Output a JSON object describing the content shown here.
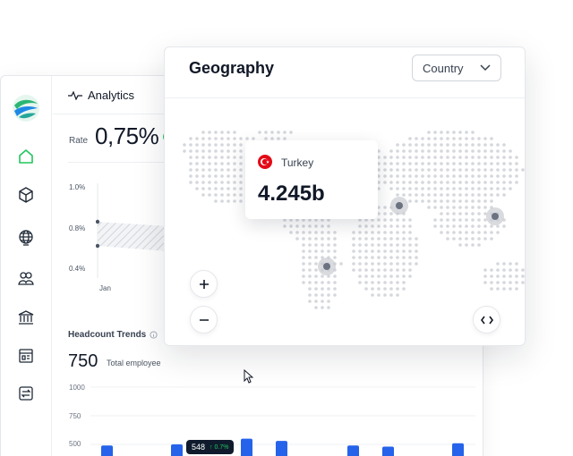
{
  "sidebar": {
    "items": [
      {
        "icon": "home-icon",
        "active": true
      },
      {
        "icon": "cube-icon"
      },
      {
        "icon": "globe-icon"
      },
      {
        "icon": "users-icon"
      },
      {
        "icon": "bank-icon"
      },
      {
        "icon": "store-icon"
      },
      {
        "icon": "exchange-icon"
      }
    ]
  },
  "analytics": {
    "title": "Analytics",
    "rate_label": "Rate",
    "rate_value": "0,75%"
  },
  "rate_chart": {
    "yticks": [
      "1.0%",
      "0.8%",
      "0.4%"
    ],
    "xticks": [
      "Jan"
    ]
  },
  "headcount": {
    "title": "Headcount Trends",
    "value": "750",
    "subtitle": "Total employee",
    "yticks": [
      "1000",
      "750",
      "500"
    ],
    "tooltip_value": "548",
    "tooltip_delta": "↑ 0.7%"
  },
  "geography": {
    "title": "Geography",
    "select_value": "Country",
    "popup_country": "Turkey",
    "popup_value": "4.245b"
  },
  "colors": {
    "accent_green": "#22c55e",
    "bar_blue": "#2563eb",
    "flag_red": "#e30a17",
    "tooltip_bg": "#0f1b2d"
  },
  "chart_data": {
    "type": "bar",
    "ylim": [
      0,
      1000
    ],
    "yticks": [
      1000,
      750,
      500
    ],
    "values": [
      490,
      500,
      550,
      530,
      490,
      480,
      510
    ],
    "xlabel": "",
    "ylabel": ""
  }
}
